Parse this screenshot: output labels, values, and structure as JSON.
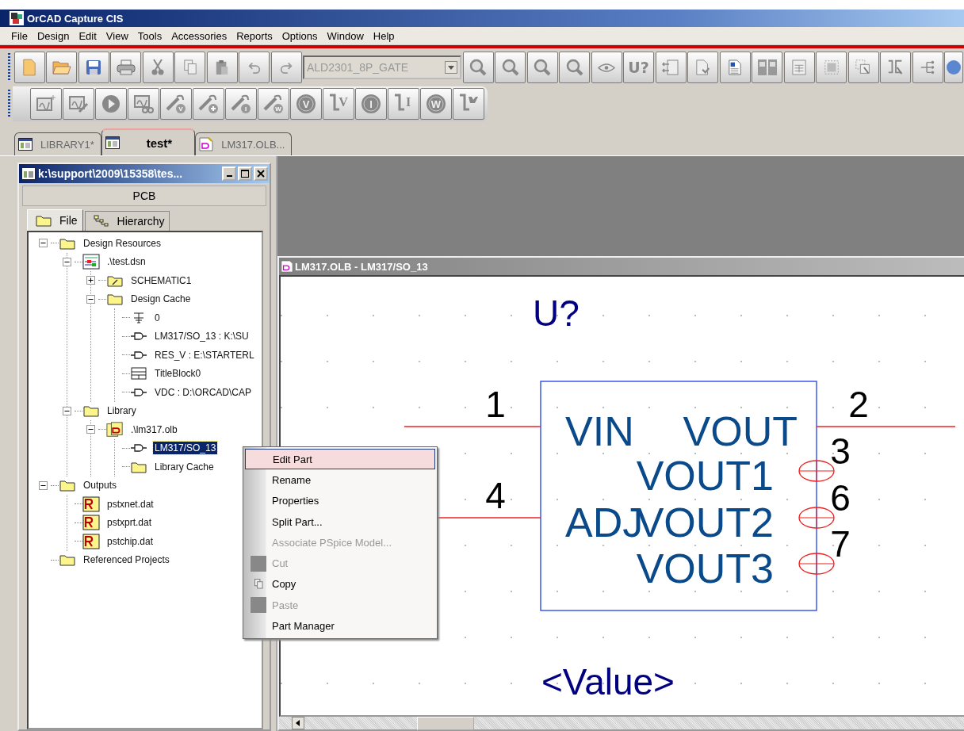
{
  "window": {
    "title": "OrCAD Capture CIS"
  },
  "menu": [
    "File",
    "Design",
    "Edit",
    "View",
    "Tools",
    "Accessories",
    "Reports",
    "Options",
    "Window",
    "Help"
  ],
  "toolbar_1": [
    {
      "kind": "new"
    },
    {
      "kind": "open"
    },
    {
      "kind": "save"
    },
    {
      "kind": "print"
    },
    {
      "kind": "cut"
    },
    {
      "kind": "copy"
    },
    {
      "kind": "paste"
    },
    {
      "kind": "undo"
    },
    {
      "kind": "redo"
    },
    {
      "kind": "combo",
      "value": "ALD2301_8P_GATE"
    },
    {
      "kind": "zoom-in"
    },
    {
      "kind": "zoom-out"
    },
    {
      "kind": "zoom-area"
    },
    {
      "kind": "zoom-all"
    },
    {
      "kind": "eye"
    },
    {
      "kind": "text",
      "label": "U?"
    },
    {
      "kind": "back-annotate"
    },
    {
      "kind": "doc-arrow"
    },
    {
      "kind": "netlist"
    },
    {
      "kind": "dual"
    },
    {
      "kind": "table-doc"
    },
    {
      "kind": "grid-select"
    },
    {
      "kind": "select-area"
    },
    {
      "kind": "part-select"
    },
    {
      "kind": "tree"
    },
    {
      "kind": "help"
    }
  ],
  "toolbar_2": [
    {
      "kind": "profile-new"
    },
    {
      "kind": "profile-edit"
    },
    {
      "kind": "run"
    },
    {
      "kind": "results"
    },
    {
      "kind": "probe",
      "label": "V"
    },
    {
      "kind": "probe-plus"
    },
    {
      "kind": "probe",
      "label": "I"
    },
    {
      "kind": "probe",
      "label": "W"
    },
    {
      "kind": "circle",
      "label": "V"
    },
    {
      "kind": "marker",
      "label": "V"
    },
    {
      "kind": "circle",
      "label": "I"
    },
    {
      "kind": "marker",
      "label": "I"
    },
    {
      "kind": "circle",
      "label": "W"
    },
    {
      "kind": "marker-diff"
    }
  ],
  "document_tabs": [
    {
      "label": "LIBRARY1*",
      "kind": "project",
      "selected": false
    },
    {
      "label": "test*",
      "kind": "project",
      "selected": true
    },
    {
      "label": "LM317.OLB...",
      "kind": "part-doc",
      "selected": false
    }
  ],
  "project_window": {
    "title": "k:\\support\\2009\\15358\\tes...",
    "header": "PCB",
    "tabs": [
      {
        "label": "File",
        "kind": "folder",
        "selected": true
      },
      {
        "label": "Hierarchy",
        "kind": "hierarchy",
        "selected": false
      }
    ],
    "tree": [
      {
        "label": "Design Resources",
        "kind": "folder",
        "expanded": true,
        "selected": false,
        "children": [
          {
            "label": ".\\test.dsn",
            "kind": "design",
            "expanded": true,
            "selected": false,
            "children": [
              {
                "label": "SCHEMATIC1",
                "kind": "schematic",
                "expanded": false,
                "selected": false
              },
              {
                "label": "Design Cache",
                "kind": "folder",
                "expanded": true,
                "selected": false,
                "children": [
                  {
                    "label": "0",
                    "kind": "power",
                    "selected": false
                  },
                  {
                    "label": "LM317/SO_13 : K:\\SU",
                    "kind": "part",
                    "selected": false
                  },
                  {
                    "label": "RES_V : E:\\STARTERL",
                    "kind": "part",
                    "selected": false
                  },
                  {
                    "label": "TitleBlock0",
                    "kind": "titleblock",
                    "selected": false
                  },
                  {
                    "label": "VDC : D:\\ORCAD\\CAP",
                    "kind": "part",
                    "selected": false
                  }
                ]
              }
            ]
          },
          {
            "label": "Library",
            "kind": "folder",
            "expanded": true,
            "selected": false,
            "children": [
              {
                "label": ".\\lm317.olb",
                "kind": "library",
                "expanded": true,
                "selected": false,
                "children": [
                  {
                    "label": "LM317/SO_13",
                    "kind": "part",
                    "selected": true
                  },
                  {
                    "label": "Library Cache",
                    "kind": "folder",
                    "selected": false
                  }
                ]
              }
            ]
          }
        ]
      },
      {
        "label": "Outputs",
        "kind": "folder",
        "expanded": true,
        "selected": false,
        "children": [
          {
            "label": "pstxnet.dat",
            "kind": "report",
            "selected": false
          },
          {
            "label": "pstxprt.dat",
            "kind": "report",
            "selected": false
          },
          {
            "label": "pstchip.dat",
            "kind": "report",
            "selected": false
          }
        ]
      },
      {
        "label": "Referenced Projects",
        "kind": "folder",
        "selected": false
      }
    ]
  },
  "schematic_window": {
    "title": "LM317.OLB - LM317/SO_13",
    "reference": "U?",
    "value": "<Value>",
    "pin_rows": [
      {
        "left": {
          "number": "1",
          "name": "VIN",
          "kind": "line"
        },
        "right": {
          "number": "2",
          "name": "VOUT",
          "kind": "line"
        }
      },
      {
        "right": {
          "number": "3",
          "name": "VOUT1",
          "kind": "circle"
        }
      },
      {
        "left": {
          "number": "4",
          "name": "ADJ",
          "kind": "line"
        },
        "right": {
          "number": "6",
          "name": "VOUT2",
          "kind": "circle"
        }
      },
      {
        "right": {
          "number": "7",
          "name": "VOUT3",
          "kind": "circle"
        }
      }
    ]
  },
  "context_menu": [
    {
      "label": "Edit Part",
      "selected": true,
      "disabled": false
    },
    {
      "label": "Rename",
      "selected": false,
      "disabled": false
    },
    {
      "label": "Properties",
      "selected": false,
      "disabled": false
    },
    {
      "label": "Split Part...",
      "selected": false,
      "disabled": false
    },
    {
      "label": "Associate PSpice Model...",
      "selected": false,
      "disabled": true
    },
    {
      "label": "Cut",
      "selected": false,
      "disabled": true,
      "kind": "placeholder-icon"
    },
    {
      "label": "Copy",
      "selected": false,
      "disabled": false,
      "kind": "copy-icon"
    },
    {
      "label": "Paste",
      "selected": false,
      "disabled": true,
      "kind": "placeholder-icon"
    },
    {
      "label": "Part Manager",
      "selected": false,
      "disabled": false
    }
  ]
}
